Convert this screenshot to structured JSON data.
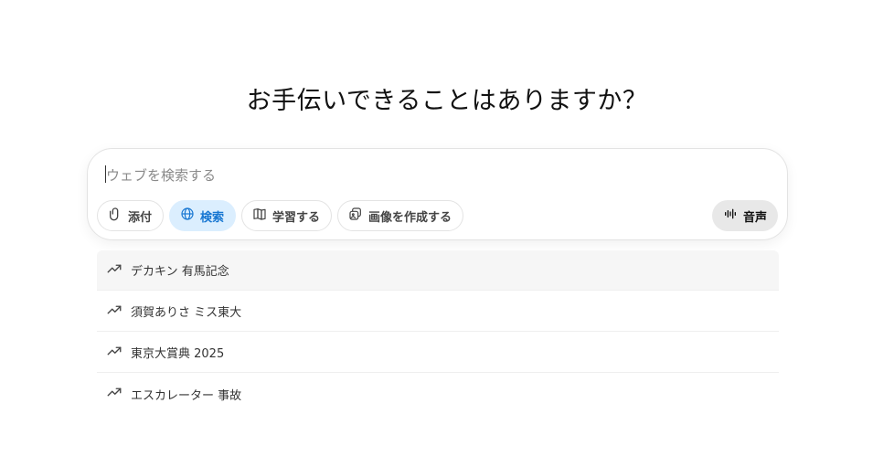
{
  "headline": "お手伝いできることはありますか？",
  "composer": {
    "placeholder": "ウェブを検索する",
    "tools": [
      {
        "label": "添付",
        "icon": "paperclip-icon"
      },
      {
        "label": "検索",
        "icon": "globe-icon",
        "active": true
      },
      {
        "label": "学習する",
        "icon": "book-icon"
      },
      {
        "label": "画像を作成する",
        "icon": "image-create-icon"
      }
    ],
    "voice_label": "音声"
  },
  "suggestions": [
    {
      "text": "デカキン 有馬記念",
      "icon": "trending-icon"
    },
    {
      "text": "須賀ありさ ミス東大",
      "icon": "trending-icon"
    },
    {
      "text": "東京大賞典 2025",
      "icon": "trending-icon"
    },
    {
      "text": "エスカレーター 事故",
      "icon": "trending-icon"
    }
  ],
  "colors": {
    "active_chip_bg": "#dbeefe",
    "active_chip_text": "#1877d2",
    "voice_bg": "#e8e8e8"
  }
}
